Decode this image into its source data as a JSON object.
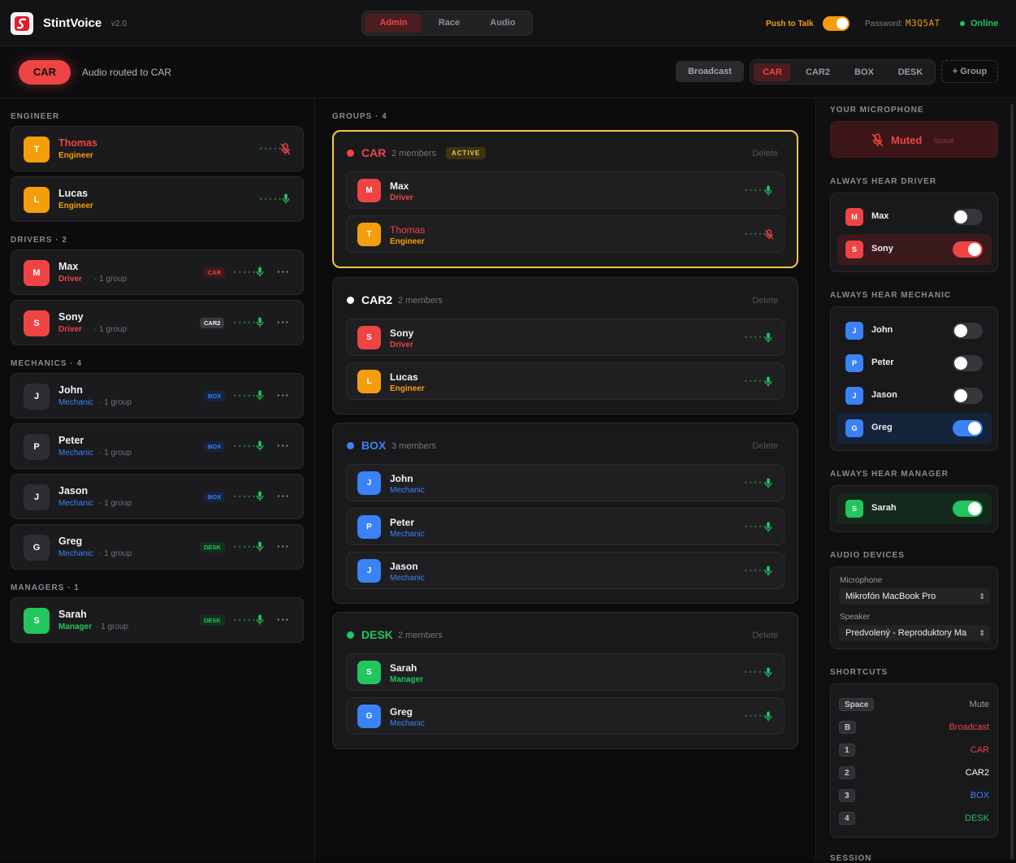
{
  "header": {
    "brand": "StintVoice",
    "version": "v2.0",
    "mode_tabs": [
      "Admin",
      "Race",
      "Audio"
    ],
    "active_mode": "Admin",
    "ptt_label": "Push to Talk",
    "ptt_enabled": true,
    "password_label": "Password:",
    "password_value": "M3Q5AT",
    "status": "Online"
  },
  "subbar": {
    "current_group": "CAR",
    "routed_text": "Audio routed to CAR",
    "broadcast_label": "Broadcast",
    "group_tabs": [
      "CAR",
      "CAR2",
      "BOX",
      "DESK"
    ],
    "active_group": "CAR",
    "add_group_label": "+ Group"
  },
  "roster": {
    "engineer_heading": "ENGINEER",
    "engineers": [
      {
        "initial": "T",
        "name": "Thomas",
        "role": "Engineer",
        "muted": true
      },
      {
        "initial": "L",
        "name": "Lucas",
        "role": "Engineer",
        "muted": false
      }
    ],
    "drivers_heading": "DRIVERS · 2",
    "drivers": [
      {
        "initial": "M",
        "name": "Max",
        "role": "Driver",
        "groups": "· 1 group",
        "tag": "CAR"
      },
      {
        "initial": "S",
        "name": "Sony",
        "role": "Driver",
        "groups": "· 1 group",
        "tag": "CAR2"
      }
    ],
    "mechanics_heading": "MECHANICS · 4",
    "mechanics": [
      {
        "initial": "J",
        "name": "John",
        "role": "Mechanic",
        "groups": "· 1 group",
        "tag": "BOX"
      },
      {
        "initial": "P",
        "name": "Peter",
        "role": "Mechanic",
        "groups": "· 1 group",
        "tag": "BOX"
      },
      {
        "initial": "J",
        "name": "Jason",
        "role": "Mechanic",
        "groups": "· 1 group",
        "tag": "BOX"
      },
      {
        "initial": "G",
        "name": "Greg",
        "role": "Mechanic",
        "groups": "· 1 group",
        "tag": "DESK"
      }
    ],
    "managers_heading": "MANAGERS · 1",
    "managers": [
      {
        "initial": "S",
        "name": "Sarah",
        "role": "Manager",
        "groups": "· 1 group",
        "tag": "DESK"
      }
    ],
    "level_glyph": "•••••",
    "more_glyph": "···"
  },
  "groups_panel": {
    "heading": "GROUPS · 4",
    "delete_label": "Delete",
    "active_label": "ACTIVE",
    "groups": [
      {
        "name": "CAR",
        "count": "2 members",
        "color": "#ef4444",
        "members": [
          {
            "initial": "M",
            "name": "Max",
            "role": "Driver"
          },
          {
            "initial": "T",
            "name": "Thomas",
            "role": "Engineer"
          }
        ]
      },
      {
        "name": "CAR2",
        "count": "2 members",
        "color": "#ffffff",
        "members": [
          {
            "initial": "S",
            "name": "Sony",
            "role": "Driver"
          },
          {
            "initial": "L",
            "name": "Lucas",
            "role": "Engineer"
          }
        ]
      },
      {
        "name": "BOX",
        "count": "3 members",
        "color": "#3b82f6",
        "members": [
          {
            "initial": "J",
            "name": "John",
            "role": "Mechanic"
          },
          {
            "initial": "P",
            "name": "Peter",
            "role": "Mechanic"
          },
          {
            "initial": "J",
            "name": "Jason",
            "role": "Mechanic"
          }
        ]
      },
      {
        "name": "DESK",
        "count": "2 members",
        "color": "#22c55e",
        "members": [
          {
            "initial": "S",
            "name": "Sarah",
            "role": "Manager"
          },
          {
            "initial": "G",
            "name": "Greg",
            "role": "Mechanic"
          }
        ]
      }
    ]
  },
  "settings": {
    "mic_heading": "YOUR MICROPHONE",
    "mic_state": "Muted",
    "mic_key": "Space",
    "driver_heading": "ALWAYS HEAR DRIVER",
    "drivers": [
      {
        "initial": "M",
        "name": "Max",
        "on": false
      },
      {
        "initial": "S",
        "name": "Sony",
        "on": true
      }
    ],
    "mechanic_heading": "ALWAYS HEAR MECHANIC",
    "mechanics": [
      {
        "initial": "J",
        "name": "John",
        "on": false
      },
      {
        "initial": "P",
        "name": "Peter",
        "on": false
      },
      {
        "initial": "J",
        "name": "Jason",
        "on": false
      },
      {
        "initial": "G",
        "name": "Greg",
        "on": true
      }
    ],
    "manager_heading": "ALWAYS HEAR MANAGER",
    "managers": [
      {
        "initial": "S",
        "name": "Sarah",
        "on": true
      }
    ],
    "devices_heading": "AUDIO DEVICES",
    "microphone_label": "Microphone",
    "microphone_value": "Mikrofón MacBook Pro",
    "speaker_label": "Speaker",
    "speaker_value": "Predvolený - Reproduktory Ma",
    "shortcuts_heading": "SHORTCUTS",
    "shortcuts": [
      {
        "key": "Space",
        "action": "Mute",
        "color": "#9a9aa0"
      },
      {
        "key": "B",
        "action": "Broadcast",
        "color": "#ef4444"
      },
      {
        "key": "1",
        "action": "CAR",
        "color": "#ef4444"
      },
      {
        "key": "2",
        "action": "CAR2",
        "color": "#ffffff"
      },
      {
        "key": "3",
        "action": "BOX",
        "color": "#3b82f6"
      },
      {
        "key": "4",
        "action": "DESK",
        "color": "#22c55e"
      }
    ],
    "session_heading": "SESSION"
  },
  "colors": {
    "driver": "#ef4444",
    "engineer": "#f59e0b",
    "mechanic": "#3b82f6",
    "manager": "#22c55e",
    "accent_red": "#ef4444",
    "accent_amber": "#f3c74a"
  }
}
